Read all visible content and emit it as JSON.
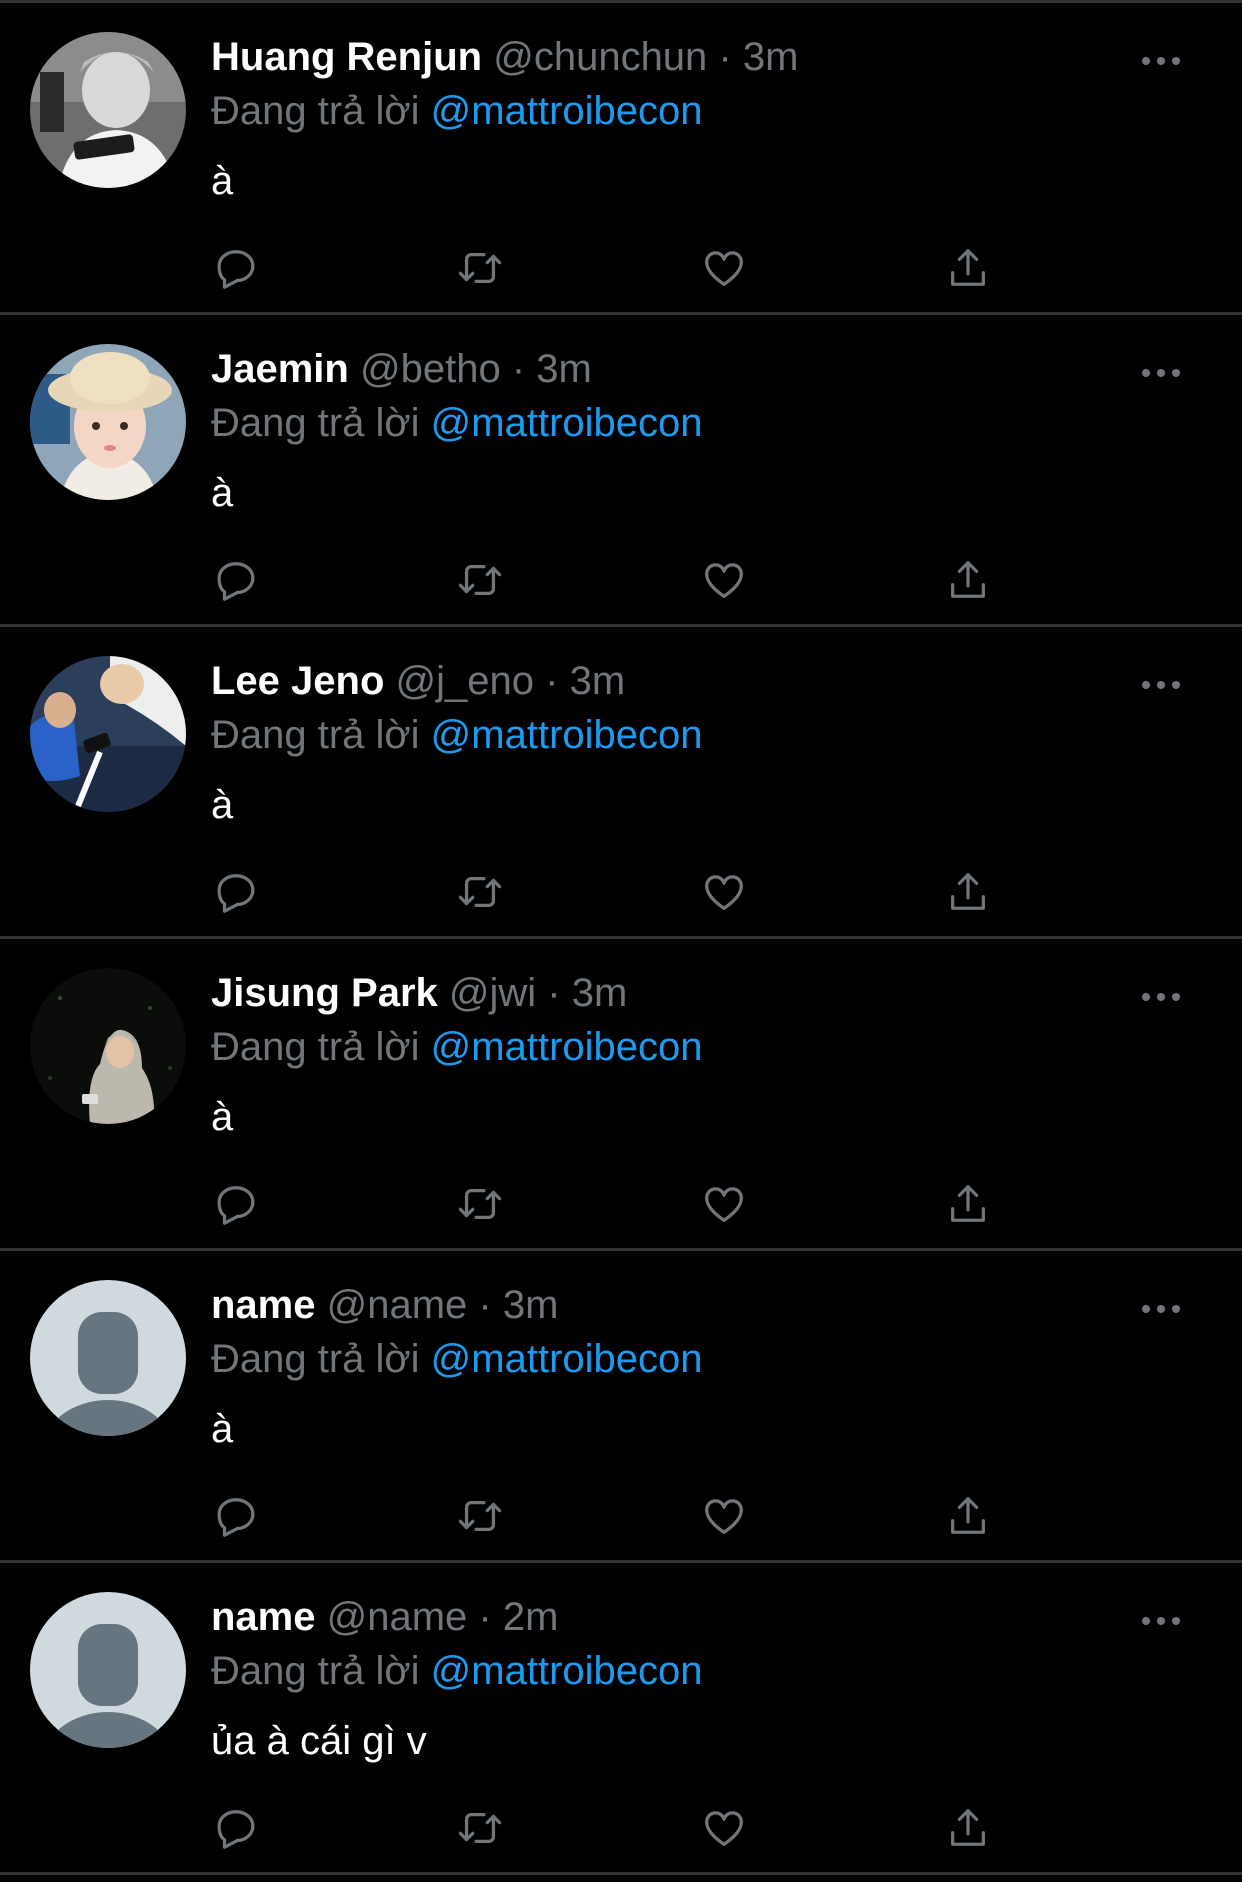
{
  "reply_prefix": "Đang trả lời",
  "colors": {
    "background": "#000000",
    "divider": "#2f3336",
    "muted": "#71767b",
    "accent": "#1d9bf0",
    "text": "#ffffff"
  },
  "tweets": [
    {
      "name": "Huang Renjun",
      "handle": "@chunchun",
      "dot": "·",
      "time": "3m",
      "reply_to": "@mattroibecon",
      "text": "à",
      "avatar": "photo-grayscale-boy-holding-phone"
    },
    {
      "name": "Jaemin",
      "handle": "@betho",
      "dot": "·",
      "time": "3m",
      "reply_to": "@mattroibecon",
      "text": "à",
      "avatar": "photo-boy-in-bucket-hat"
    },
    {
      "name": "Lee Jeno",
      "handle": "@j_eno",
      "dot": "·",
      "time": "3m",
      "reply_to": "@mattroibecon",
      "text": "à",
      "avatar": "photo-two-boys-with-phone"
    },
    {
      "name": "Jisung Park",
      "handle": "@jwi",
      "dot": "·",
      "time": "3m",
      "reply_to": "@mattroibecon",
      "text": "à",
      "avatar": "photo-boy-in-hoodie-at-night"
    },
    {
      "name": "name",
      "handle": "@name",
      "dot": "·",
      "time": "3m",
      "reply_to": "@mattroibecon",
      "text": "à",
      "avatar": "default-profile-placeholder"
    },
    {
      "name": "name",
      "handle": "@name",
      "dot": "·",
      "time": "2m",
      "reply_to": "@mattroibecon",
      "text": "ủa à cái gì v",
      "avatar": "default-profile-placeholder"
    }
  ],
  "action_icons": [
    "reply-icon",
    "retweet-icon",
    "like-icon",
    "share-icon"
  ]
}
